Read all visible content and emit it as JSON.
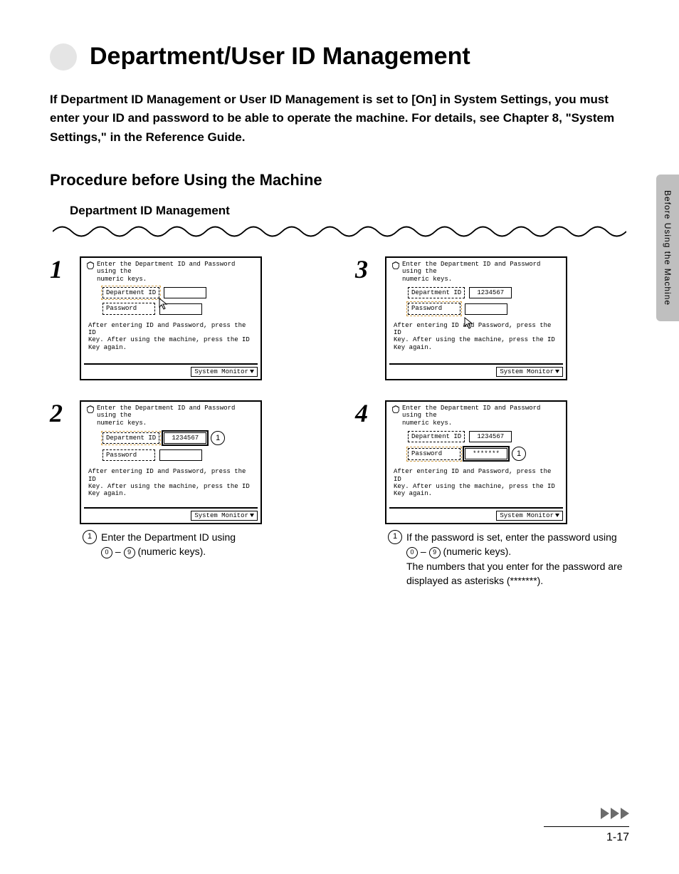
{
  "title": "Department/User ID Management",
  "intro": "If Department ID Management or User ID Management is set to [On] in System Settings, you must enter your ID and password to be able to operate the machine. For details, see Chapter 8, \"System Settings,\" in the Reference Guide.",
  "section_heading": "Procedure before Using the Machine",
  "sub_heading": "Department ID Management",
  "side_tab": "Before Using the Machine",
  "screen": {
    "top_line1": "Enter the Department ID and Password using the",
    "top_line2": "numeric keys.",
    "dept_label": "Department ID",
    "pass_label": "Password",
    "instr_line1": "After entering ID and Password, press the ID",
    "instr_line2": "Key. After using the machine, press the ID",
    "instr_line3": "Key again.",
    "sysmon": "System Monitor",
    "id_value": "1234567",
    "pass_value": "*******"
  },
  "steps": {
    "s1": "1",
    "s2": "2",
    "s3": "3",
    "s4": "4"
  },
  "captions": {
    "step2_a": "Enter the Department ID using",
    "step2_b": "(numeric keys).",
    "step4_a": "If the password is set, enter the password using",
    "step4_b": "(numeric keys).",
    "step4_c": "The numbers that you enter for the password are displayed as asterisks (*******).",
    "key0": "0",
    "key9": "9",
    "dash": "–"
  },
  "circled_one": "1",
  "page_number": "1-17"
}
